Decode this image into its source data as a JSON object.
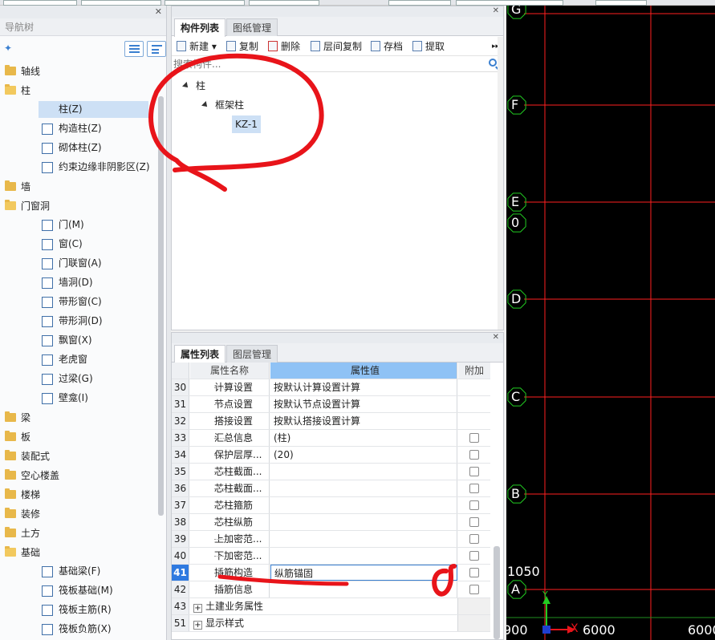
{
  "nav": {
    "header": "导航树",
    "items": [
      {
        "label": "轴线",
        "level": 0,
        "open": false
      },
      {
        "label": "柱",
        "level": 0,
        "open": true
      },
      {
        "label": "柱(Z)",
        "level": 1,
        "selected": true,
        "icon": "column-icon"
      },
      {
        "label": "构造柱(Z)",
        "level": 1,
        "icon": "construct-column-icon"
      },
      {
        "label": "砌体柱(Z)",
        "level": 1,
        "icon": "masonry-column-icon"
      },
      {
        "label": "约束边缘非阴影区(Z)",
        "level": 1,
        "icon": "hatch-icon"
      },
      {
        "label": "墙",
        "level": 0,
        "open": false
      },
      {
        "label": "门窗洞",
        "level": 0,
        "open": true
      },
      {
        "label": "门(M)",
        "level": 1,
        "icon": "door-icon"
      },
      {
        "label": "窗(C)",
        "level": 1,
        "icon": "window-icon"
      },
      {
        "label": "门联窗(A)",
        "level": 1,
        "icon": "door-window-icon"
      },
      {
        "label": "墙洞(D)",
        "level": 1,
        "icon": "wall-opening-icon"
      },
      {
        "label": "带形窗(C)",
        "level": 1,
        "icon": "strip-window-icon"
      },
      {
        "label": "带形洞(D)",
        "level": 1,
        "icon": "strip-opening-icon"
      },
      {
        "label": "飘窗(X)",
        "level": 1,
        "icon": "bay-window-icon"
      },
      {
        "label": "老虎窗",
        "level": 1,
        "icon": "dormer-icon"
      },
      {
        "label": "过梁(G)",
        "level": 1,
        "icon": "lintel-icon"
      },
      {
        "label": "壁龛(I)",
        "level": 1,
        "icon": "niche-icon"
      },
      {
        "label": "梁",
        "level": 0,
        "open": false
      },
      {
        "label": "板",
        "level": 0,
        "open": false
      },
      {
        "label": "装配式",
        "level": 0,
        "open": false
      },
      {
        "label": "空心楼盖",
        "level": 0,
        "open": false
      },
      {
        "label": "楼梯",
        "level": 0,
        "open": false
      },
      {
        "label": "装修",
        "level": 0,
        "open": false
      },
      {
        "label": "土方",
        "level": 0,
        "open": false
      },
      {
        "label": "基础",
        "level": 0,
        "open": true
      },
      {
        "label": "基础梁(F)",
        "level": 1,
        "icon": "foundation-beam-icon"
      },
      {
        "label": "筏板基础(M)",
        "level": 1,
        "icon": "raft-icon"
      },
      {
        "label": "筏板主筋(R)",
        "level": 1,
        "icon": "raft-main-rebar-icon"
      },
      {
        "label": "筏板负筋(X)",
        "level": 1,
        "icon": "raft-neg-rebar-icon"
      }
    ]
  },
  "components": {
    "tabs": [
      "构件列表",
      "图纸管理"
    ],
    "toolbar": [
      "新建",
      "复制",
      "删除",
      "层间复制",
      "存档",
      "提取"
    ],
    "search_placeholder": "搜索构件...",
    "tree": {
      "root": "柱",
      "child": "框架柱",
      "leaf": "KZ-1"
    }
  },
  "properties": {
    "tabs": [
      "属性列表",
      "图层管理"
    ],
    "headers": {
      "name": "属性名称",
      "value": "属性值",
      "add": "附加"
    },
    "rows": [
      {
        "num": "30",
        "name": "计算设置",
        "value": "按默认计算设置计算",
        "checkbox": false
      },
      {
        "num": "31",
        "name": "节点设置",
        "value": "按默认节点设置计算",
        "checkbox": false
      },
      {
        "num": "32",
        "name": "搭接设置",
        "value": "按默认搭接设置计算",
        "checkbox": false
      },
      {
        "num": "33",
        "name": "汇总信息",
        "value": "(柱)",
        "checkbox": true
      },
      {
        "num": "34",
        "name": "保护层厚...",
        "value": "(20)",
        "checkbox": true
      },
      {
        "num": "35",
        "name": "芯柱截面...",
        "value": "",
        "checkbox": true
      },
      {
        "num": "36",
        "name": "芯柱截面...",
        "value": "",
        "checkbox": true
      },
      {
        "num": "37",
        "name": "芯柱箍筋",
        "value": "",
        "checkbox": true
      },
      {
        "num": "38",
        "name": "芯柱纵筋",
        "value": "",
        "checkbox": true
      },
      {
        "num": "39",
        "name": "上加密范...",
        "value": "",
        "checkbox": true
      },
      {
        "num": "40",
        "name": "下加密范...",
        "value": "",
        "checkbox": true
      },
      {
        "num": "41",
        "name": "插筋构造",
        "value": "纵筋锚固",
        "checkbox": true,
        "selected": true
      },
      {
        "num": "42",
        "name": "插筋信息",
        "value": "",
        "checkbox": true
      }
    ],
    "groups": [
      {
        "num": "43",
        "label": "土建业务属性"
      },
      {
        "num": "51",
        "label": "显示样式"
      }
    ]
  },
  "cad": {
    "axes": [
      "G",
      "F",
      "E",
      "0",
      "D",
      "C",
      "B",
      "A"
    ],
    "dims": [
      "1050",
      "900",
      "6000",
      "6000"
    ],
    "ucs": {
      "y": "Y",
      "x": "X"
    },
    "colors": {
      "grid": "#ff2020",
      "bubble": "#22cc22",
      "bg": "#000000"
    }
  },
  "annotation_color": "#e8141a"
}
